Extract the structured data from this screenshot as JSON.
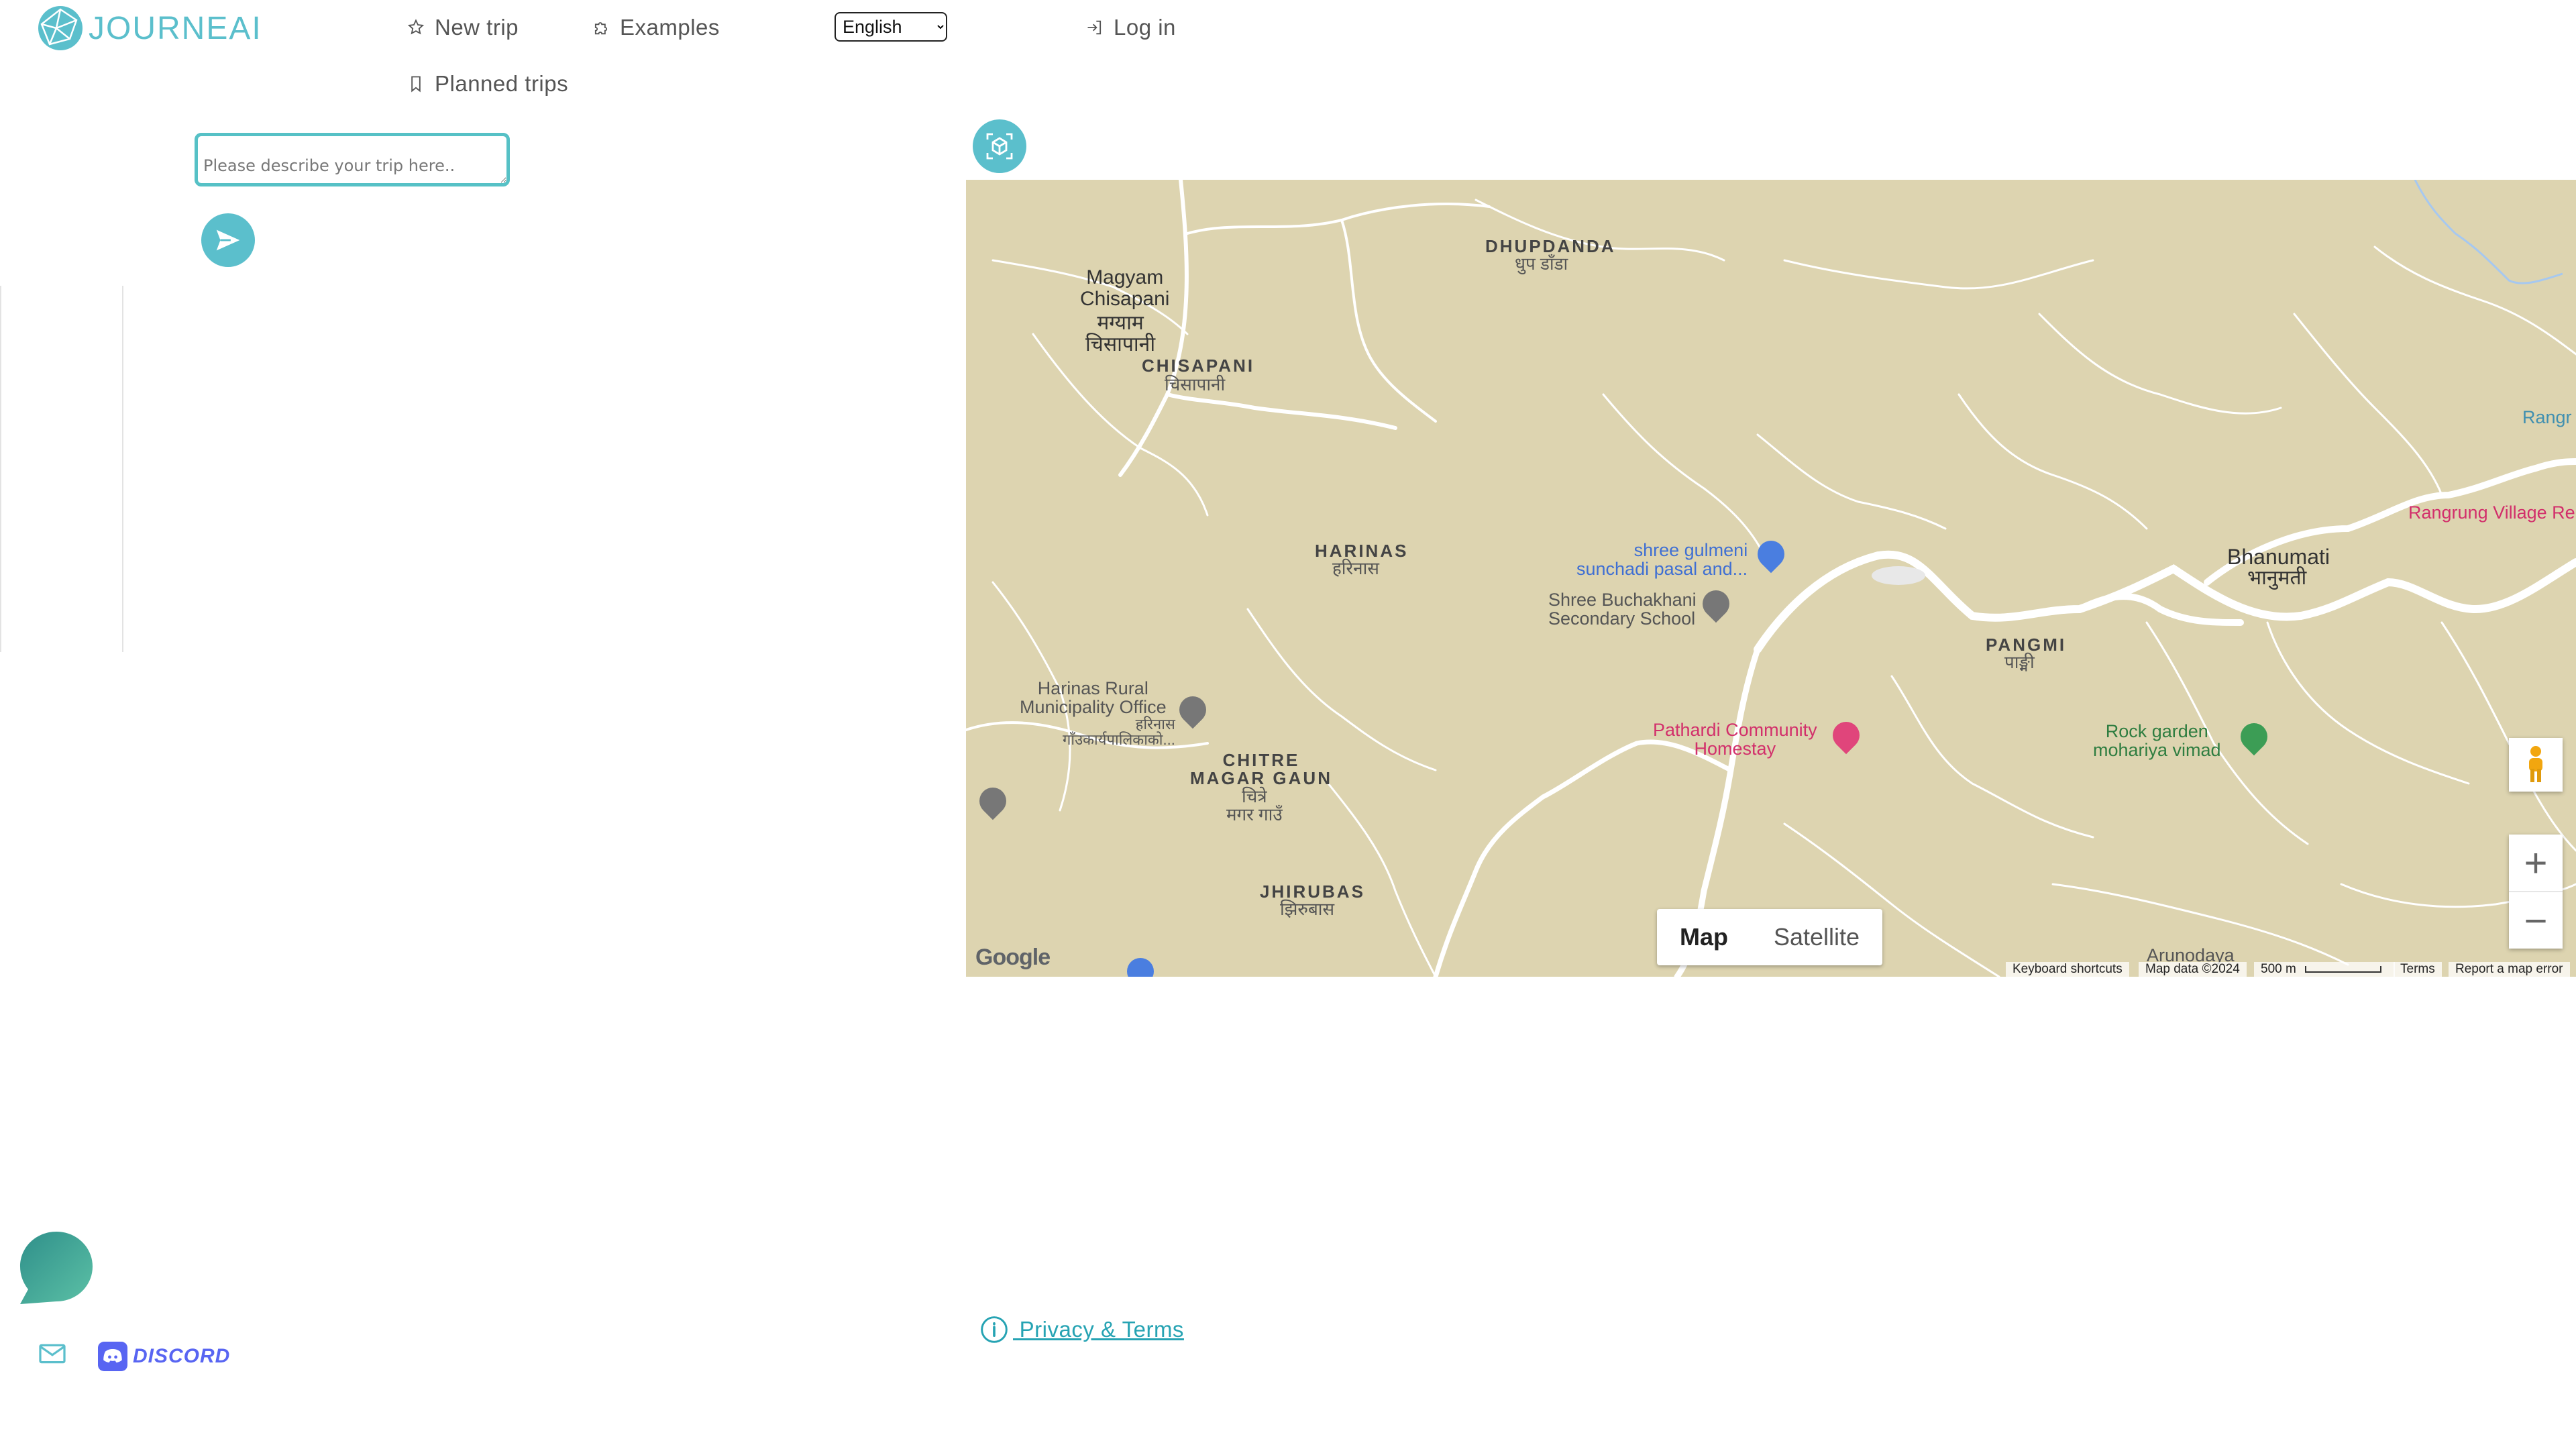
{
  "header": {
    "logo_text": "JOURNEAI",
    "nav": {
      "new_trip": "New trip",
      "examples": "Examples",
      "log_in": "Log in",
      "planned_trips": "Planned trips"
    },
    "language": {
      "selected": "English"
    }
  },
  "search": {
    "placeholder": "Please describe your trip here..",
    "icons": {
      "send": "send-icon",
      "focus": "cube-icon"
    }
  },
  "map": {
    "labels": {
      "magyam": "Magyam\nChisapani",
      "magyam_dev": "मग्याम\nचिसापानी",
      "chisapani": "CHISAPANI",
      "chisapani_dev": "चिसापानी",
      "dhupdanda": "DHUPDANDA",
      "dhupdanda_dev": "धुप डाँडा",
      "harinas": "HARINAS",
      "harinas_dev": "हरिनास",
      "gulmeni": "shree gulmeni\nsunchadi pasal and...",
      "buchakhani": "Shree Buchakhani\nSecondary School",
      "bhanumati": "Bhanumati",
      "bhanumati_dev": "भानुमती",
      "pangmi": "PANGMI",
      "pangmi_dev": "पाङ्मी",
      "rangrung_edge": "Rangr",
      "rangrung_village": "Rangrung Village Re",
      "harinas_office": "Harinas Rural\nMunicipality Office",
      "harinas_office_dev": "हरिनास\nगाँउकार्यपालिकाको...",
      "chitre": "CHITRE\nMAGAR GAUN",
      "chitre_dev": "चित्रे\nमगर गाउँ",
      "pathardi": "Pathardi Community\nHomestay",
      "rockgarden": "Rock garden\nmohariya vimad",
      "jhirubas": "JHIRUBAS",
      "jhirubas_dev": "झिरुबास",
      "arunodaya": "Arunodaya"
    },
    "type_toggle": {
      "map": "Map",
      "satellite": "Satellite",
      "selected": "Map"
    },
    "zoom": {
      "in": "+",
      "out": "−"
    },
    "google": "Google",
    "attribution": {
      "shortcuts": "Keyboard shortcuts",
      "data": "Map data ©2024",
      "scale": "500 m",
      "terms": "Terms",
      "report": "Report a map error"
    },
    "colors": {
      "land": "#ddd4b0",
      "road": "#ffffff",
      "water": "#a6c8f0"
    }
  },
  "footer": {
    "privacy": " Privacy & Terms",
    "discord": "DISCORD"
  },
  "colors": {
    "accent": "#5bbfcc",
    "discord": "#5865f2"
  }
}
